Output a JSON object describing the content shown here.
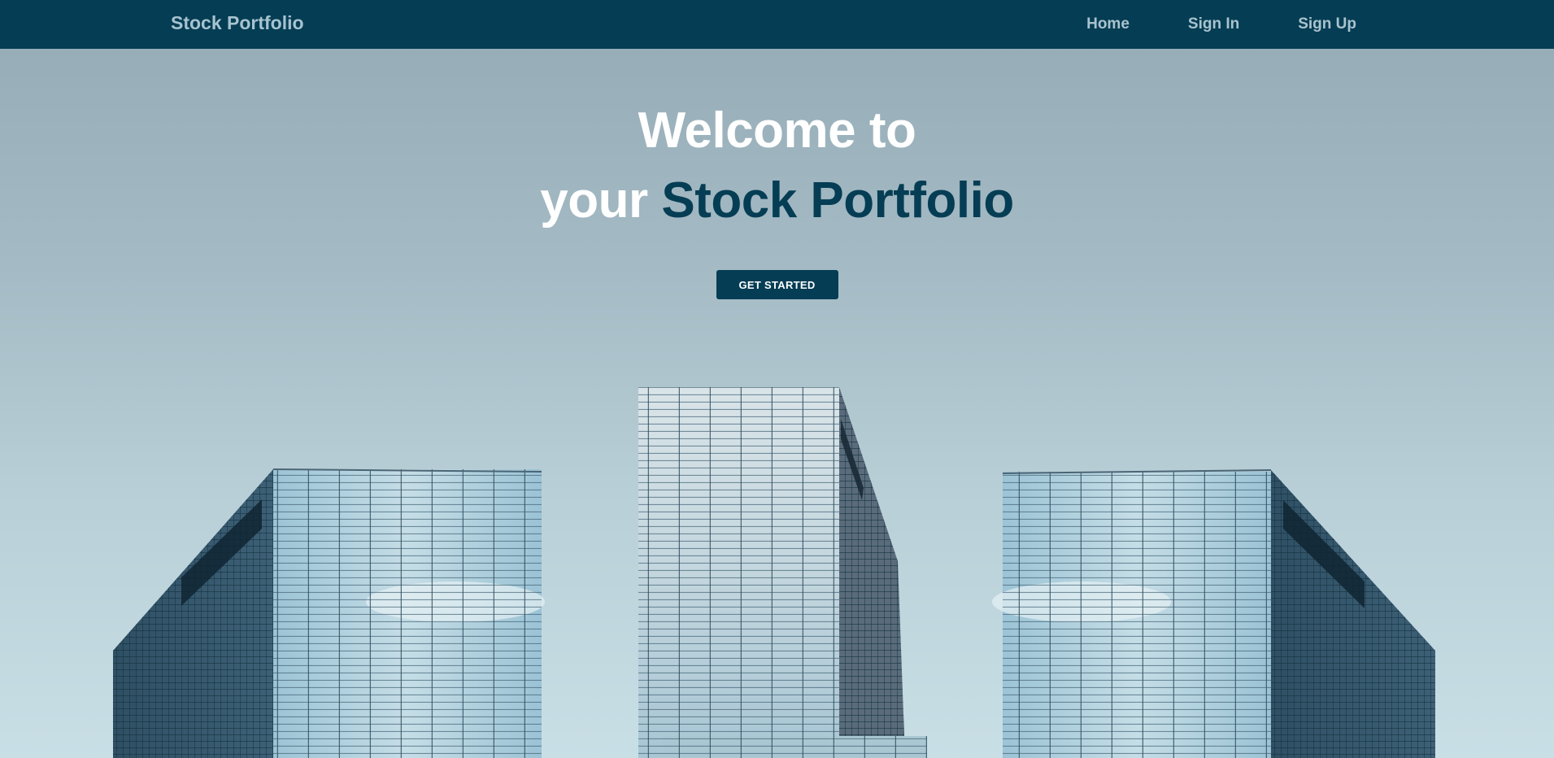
{
  "navbar": {
    "brand": "Stock Portfolio",
    "links": [
      {
        "label": "Home"
      },
      {
        "label": "Sign In"
      },
      {
        "label": "Sign Up"
      }
    ]
  },
  "hero": {
    "line1": "Welcome to",
    "line2_prefix": "your ",
    "line2_accent": "Stock Portfolio",
    "cta_label": "GET STARTED"
  },
  "colors": {
    "navbar_bg": "#053d54",
    "accent": "#053d54",
    "nav_text": "#a9c3ce",
    "hero_text": "#ffffff"
  },
  "background_image": "glass-skyscrapers-photo"
}
